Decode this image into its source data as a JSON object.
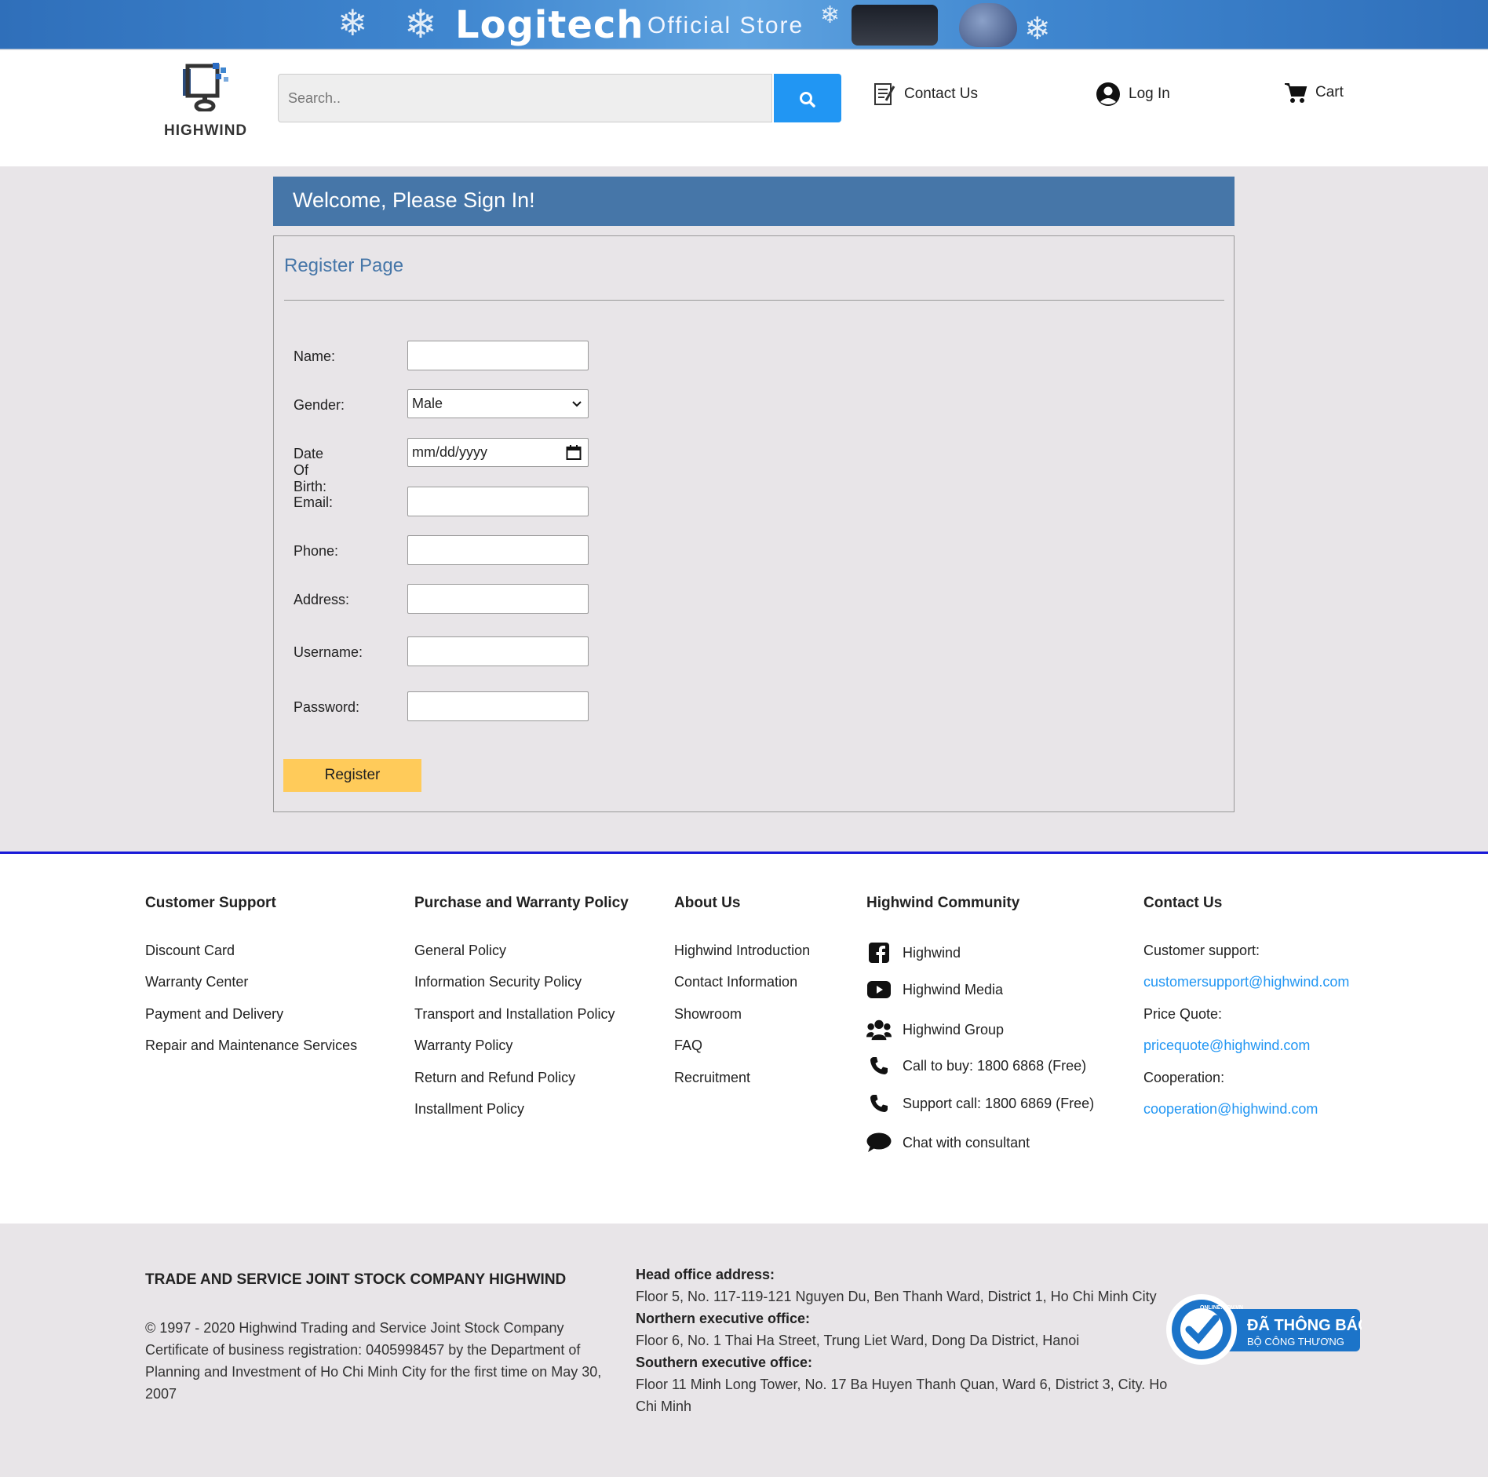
{
  "banner": {
    "brand": "Logitech",
    "store": "Official Store"
  },
  "header": {
    "logo_text": "HIGHWIND",
    "search_placeholder": "Search..",
    "contact_label": "Contact Us",
    "login_label": "Log In",
    "cart_label": "Cart"
  },
  "main": {
    "welcome": "Welcome, Please Sign In!",
    "panel_title": "Register Page",
    "fields": {
      "name": "Name:",
      "gender": "Gender:",
      "gender_value": "Male",
      "dob": "Date Of Birth:",
      "dob_placeholder": "mm/dd/yyyy",
      "email": "Email:",
      "phone": "Phone:",
      "address": "Address:",
      "username": "Username:",
      "password": "Password:"
    },
    "register_label": "Register"
  },
  "footer": {
    "customer_support": {
      "title": "Customer Support",
      "items": [
        "Discount Card",
        "Warranty Center",
        "Payment and Delivery",
        "Repair and Maintenance Services"
      ]
    },
    "policy": {
      "title": "Purchase and Warranty Policy",
      "items": [
        "General Policy",
        "Information Security Policy",
        "Transport and Installation Policy",
        "Warranty Policy",
        "Return and Refund Policy",
        "Installment Policy"
      ]
    },
    "about": {
      "title": "About Us",
      "items": [
        "Highwind Introduction",
        "Contact Information",
        "Showroom",
        "FAQ",
        "Recruitment"
      ]
    },
    "community": {
      "title": "Highwind Community",
      "items": [
        {
          "icon": "facebook-icon",
          "label": "Highwind"
        },
        {
          "icon": "youtube-icon",
          "label": "Highwind Media"
        },
        {
          "icon": "group-icon",
          "label": "Highwind Group"
        },
        {
          "icon": "phone-icon",
          "label": "Call to buy: 1800 6868 (Free)"
        },
        {
          "icon": "phone-icon",
          "label": "Support call: 1800 6869 (Free)"
        },
        {
          "icon": "chat-icon",
          "label": "Chat with consultant"
        }
      ]
    },
    "contact": {
      "title": "Contact Us",
      "support_label": "Customer support:",
      "support_email": "customersupport@highwind.com",
      "quote_label": "Price Quote:",
      "quote_email": "pricequote@highwind.com",
      "coop_label": "Cooperation:",
      "coop_email": "cooperation@highwind.com"
    }
  },
  "bottom": {
    "company": "TRADE AND SERVICE JOINT STOCK COMPANY HIGHWIND",
    "copyright": "© 1997 - 2020 Highwind Trading and Service Joint Stock Company Certificate of business registration: 0405998457 by the Department of Planning and Investment of Ho Chi Minh City for the first time on May 30, 2007",
    "head_label": "Head office address:",
    "head_value": "Floor 5, No. 117-119-121 Nguyen Du, Ben Thanh Ward, District 1, Ho Chi Minh City",
    "north_label": "Northern executive office:",
    "north_value": "Floor 6, No. 1 Thai Ha Street, Trung Liet Ward, Dong Da District, Hanoi",
    "south_label": "Southern executive office:",
    "south_value": "Floor 11 Minh Long Tower, No. 17 Ba Huyen Thanh Quan, Ward 6, District 3, City. Ho Chi Minh",
    "badge_title": "ĐÃ THÔNG BÁO",
    "badge_sub": "BỘ CÔNG THƯƠNG",
    "badge_ring": "ONLINE.GOV.VN"
  },
  "colors": {
    "accent": "#4676a8",
    "search": "#2196f3",
    "register": "#ffcb5a",
    "footer_rule": "#1818d8"
  }
}
